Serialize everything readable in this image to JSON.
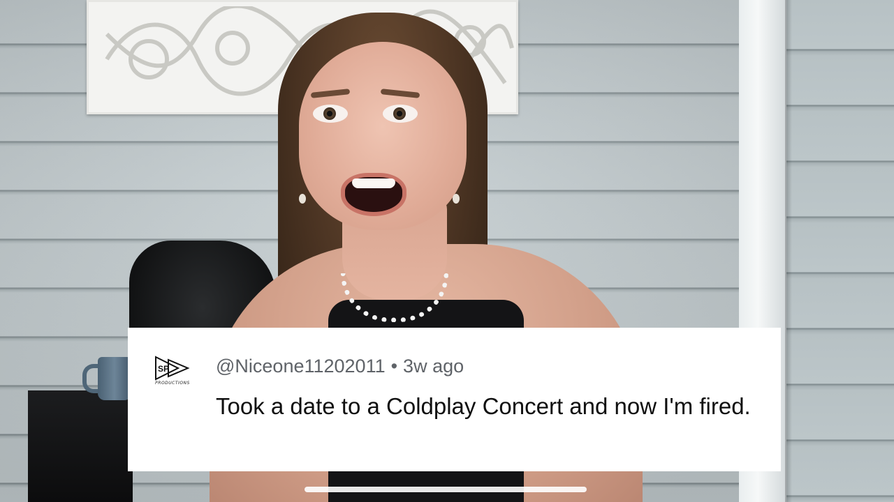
{
  "comment": {
    "username": "@Niceone11202011",
    "separator": "•",
    "timestamp": "3w ago",
    "text": "Took a date to a Coldplay Concert and now I'm fired.",
    "avatar_logo_text": "SP",
    "avatar_caption": "PRODUCTIONS"
  },
  "colors": {
    "card_background": "#ffffff",
    "meta_text": "#5f6368",
    "comment_text": "#0f0f0f"
  },
  "icons": {
    "avatar": "sp-productions-logo-icon"
  }
}
